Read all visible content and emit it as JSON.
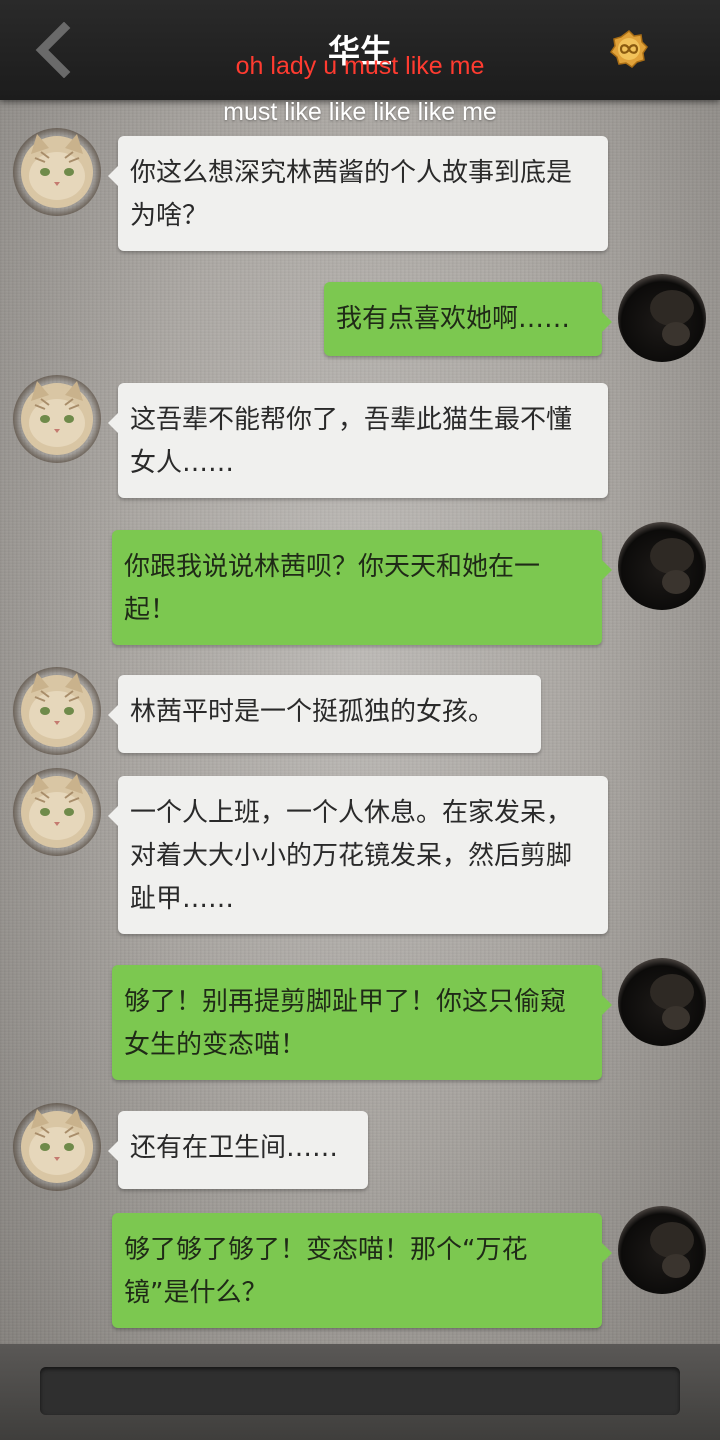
{
  "header": {
    "title": "华生",
    "back_icon": "chevron-left-icon",
    "coin_icon": "infinity-coin-icon"
  },
  "overlay": {
    "line1": "oh lady u must like me",
    "line2": "must like like like like me"
  },
  "messages": [
    {
      "side": "left",
      "text": "你这么想深究林茜酱的个人故事到底是为啥？"
    },
    {
      "side": "right",
      "text": "我有点喜欢她啊……"
    },
    {
      "side": "left",
      "text": "这吾辈不能帮你了，吾辈此猫生最不懂女人……"
    },
    {
      "side": "right",
      "text": "你跟我说说林茜呗？你天天和她在一起！"
    },
    {
      "side": "left",
      "text": "林茜平时是一个挺孤独的女孩。"
    },
    {
      "side": "left",
      "text": "一个人上班，一个人休息。在家发呆，对着大大小小的万花镜发呆，然后剪脚趾甲……"
    },
    {
      "side": "right",
      "text": "够了！别再提剪脚趾甲了！你这只偷窥女生的变态喵！"
    },
    {
      "side": "left",
      "text": "还有在卫生间……"
    },
    {
      "side": "right",
      "text": "够了够了够了！变态喵！那个“万花镜”是什么？"
    }
  ],
  "colors": {
    "header": "#1f1f1f",
    "left_bubble": "#f0f0ee",
    "right_bubble": "#7cc850",
    "overlay_red": "#ff3b30"
  }
}
